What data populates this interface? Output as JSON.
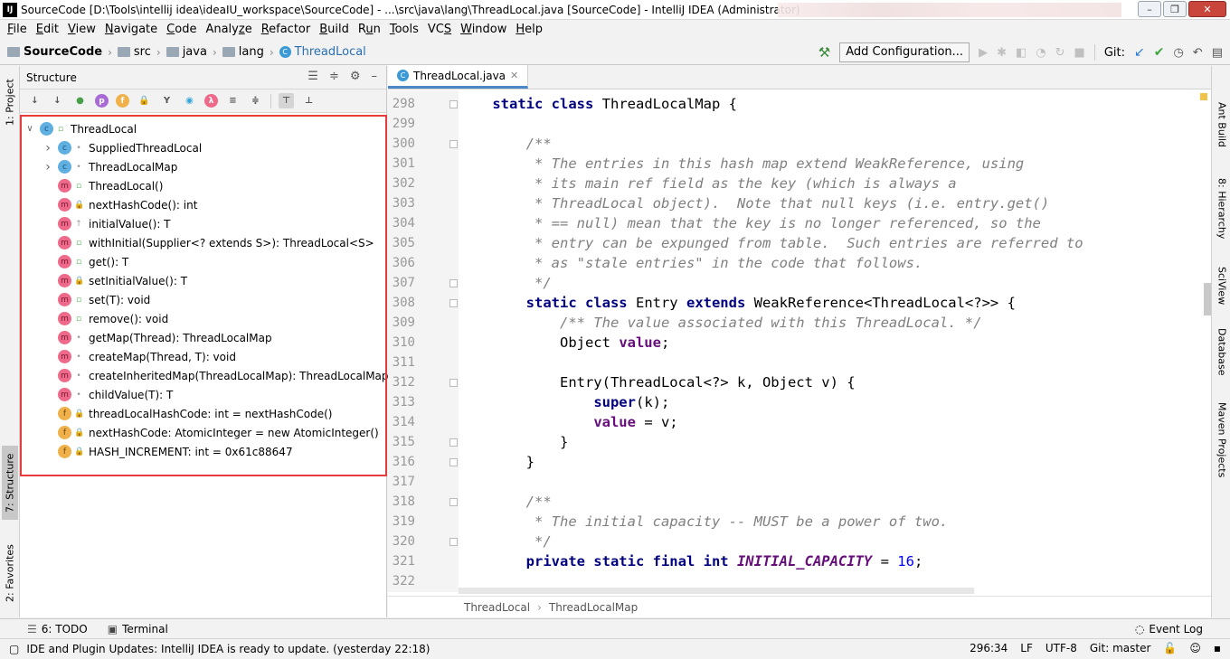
{
  "window": {
    "title": "SourceCode [D:\\Tools\\intellij idea\\ideaIU_workspace\\SourceCode] - ...\\src\\java\\lang\\ThreadLocal.java [SourceCode] - IntelliJ IDEA (Administrator)",
    "icon_text": "IJ"
  },
  "menu": [
    "File",
    "Edit",
    "View",
    "Navigate",
    "Code",
    "Analyze",
    "Refactor",
    "Build",
    "Run",
    "Tools",
    "VCS",
    "Window",
    "Help"
  ],
  "menu_mnemonics": [
    "F",
    "E",
    "V",
    "N",
    "C",
    "z",
    "R",
    "B",
    "u",
    "T",
    "S",
    "W",
    "H"
  ],
  "breadcrumbs": [
    {
      "label": "SourceCode",
      "icon": "folder-icon"
    },
    {
      "label": "src",
      "icon": "folder-icon"
    },
    {
      "label": "java",
      "icon": "folder-icon"
    },
    {
      "label": "lang",
      "icon": "folder-icon"
    },
    {
      "label": "ThreadLocal",
      "icon": "class-icon"
    }
  ],
  "toolbar": {
    "add_configuration": "Add Configuration...",
    "git_label": "Git:"
  },
  "left_tabs": [
    "1: Project",
    "7: Structure",
    "2: Favorites"
  ],
  "right_tabs": [
    "Ant Build",
    "8: Hierarchy",
    "SciView",
    "Database",
    "Maven Projects"
  ],
  "structure": {
    "title": "Structure",
    "toolbar_icons": [
      "sort-visibility-icon",
      "sort-alpha-icon",
      "show-inherited-icon",
      "show-properties-icon",
      "show-fields-icon",
      "show-non-public-icon",
      "show-lambdas-icon",
      "show-anonymous-icon",
      "lambda-icon",
      "expand-all-icon",
      "collapse-all-icon",
      "autoscroll-to-source-icon",
      "autoscroll-from-source-icon"
    ],
    "items": [
      {
        "label": "ThreadLocal",
        "kind": "c",
        "vis": "pub",
        "level": 0,
        "chevron": "down"
      },
      {
        "label": "SuppliedThreadLocal",
        "kind": "c",
        "vis": "pkg",
        "level": 1,
        "chevron": "right"
      },
      {
        "label": "ThreadLocalMap",
        "kind": "c",
        "vis": "pkg",
        "level": 1,
        "chevron": "right"
      },
      {
        "label": "ThreadLocal()",
        "kind": "m",
        "vis": "pub",
        "level": 1,
        "chevron": ""
      },
      {
        "label": "nextHashCode(): int",
        "kind": "m",
        "vis": "priv",
        "level": 1,
        "chevron": ""
      },
      {
        "label": "initialValue(): T",
        "kind": "m",
        "vis": "prot",
        "level": 1,
        "chevron": ""
      },
      {
        "label": "withInitial(Supplier<? extends S>): ThreadLocal<S>",
        "kind": "m",
        "vis": "pub",
        "level": 1,
        "chevron": ""
      },
      {
        "label": "get(): T",
        "kind": "m",
        "vis": "pub",
        "level": 1,
        "chevron": ""
      },
      {
        "label": "setInitialValue(): T",
        "kind": "m",
        "vis": "priv",
        "level": 1,
        "chevron": ""
      },
      {
        "label": "set(T): void",
        "kind": "m",
        "vis": "pub",
        "level": 1,
        "chevron": ""
      },
      {
        "label": "remove(): void",
        "kind": "m",
        "vis": "pub",
        "level": 1,
        "chevron": ""
      },
      {
        "label": "getMap(Thread): ThreadLocalMap",
        "kind": "m",
        "vis": "pkg",
        "level": 1,
        "chevron": ""
      },
      {
        "label": "createMap(Thread, T): void",
        "kind": "m",
        "vis": "pkg",
        "level": 1,
        "chevron": ""
      },
      {
        "label": "createInheritedMap(ThreadLocalMap): ThreadLocalMap",
        "kind": "m",
        "vis": "pkg",
        "level": 1,
        "chevron": ""
      },
      {
        "label": "childValue(T): T",
        "kind": "m",
        "vis": "pkg",
        "level": 1,
        "chevron": ""
      },
      {
        "label": "threadLocalHashCode: int = nextHashCode()",
        "kind": "f",
        "vis": "priv",
        "level": 1,
        "chevron": ""
      },
      {
        "label": "nextHashCode: AtomicInteger = new AtomicInteger()",
        "kind": "f",
        "vis": "priv",
        "level": 1,
        "chevron": ""
      },
      {
        "label": "HASH_INCREMENT: int = 0x61c88647",
        "kind": "f",
        "vis": "priv",
        "level": 1,
        "chevron": ""
      }
    ]
  },
  "editor": {
    "tab": "ThreadLocal.java",
    "breadcrumb": [
      "ThreadLocal",
      "ThreadLocalMap"
    ],
    "lines": [
      {
        "n": "298",
        "fold": true,
        "segs": [
          [
            "",
            "    "
          ],
          [
            "kw",
            "static class "
          ],
          [
            "pl",
            "ThreadLocalMap {"
          ]
        ]
      },
      {
        "n": "299",
        "fold": false,
        "segs": []
      },
      {
        "n": "300",
        "fold": true,
        "segs": [
          [
            "cm",
            "        /**"
          ]
        ]
      },
      {
        "n": "301",
        "fold": false,
        "segs": [
          [
            "cm",
            "         * The entries in this hash map extend WeakReference, using"
          ]
        ]
      },
      {
        "n": "302",
        "fold": false,
        "segs": [
          [
            "cm",
            "         * its main ref field as the key (which is always a"
          ]
        ]
      },
      {
        "n": "303",
        "fold": false,
        "segs": [
          [
            "cm",
            "         * ThreadLocal object).  Note that null keys (i.e. entry.get()"
          ]
        ]
      },
      {
        "n": "304",
        "fold": false,
        "segs": [
          [
            "cm",
            "         * == null) mean that the key is no longer referenced, so the"
          ]
        ]
      },
      {
        "n": "305",
        "fold": false,
        "segs": [
          [
            "cm",
            "         * entry can be expunged from table.  Such entries are referred to"
          ]
        ]
      },
      {
        "n": "306",
        "fold": false,
        "segs": [
          [
            "cm",
            "         * as \"stale entries\" in the code that follows."
          ]
        ]
      },
      {
        "n": "307",
        "fold": true,
        "segs": [
          [
            "cm",
            "         */"
          ]
        ]
      },
      {
        "n": "308",
        "fold": true,
        "segs": [
          [
            "",
            "        "
          ],
          [
            "kw",
            "static class "
          ],
          [
            "pl",
            "Entry "
          ],
          [
            "kw",
            "extends "
          ],
          [
            "pl",
            "WeakReference<ThreadLocal<?>> {"
          ]
        ]
      },
      {
        "n": "309",
        "fold": false,
        "segs": [
          [
            "",
            "            "
          ],
          [
            "cm",
            "/** The value associated with this ThreadLocal. */"
          ]
        ]
      },
      {
        "n": "310",
        "fold": false,
        "segs": [
          [
            "",
            "            "
          ],
          [
            "pl",
            "Object "
          ],
          [
            "fld",
            "value"
          ],
          [
            "pl",
            ";"
          ]
        ]
      },
      {
        "n": "311",
        "fold": false,
        "segs": []
      },
      {
        "n": "312",
        "fold": true,
        "segs": [
          [
            "",
            "            "
          ],
          [
            "pl",
            "Entry(ThreadLocal<?> k, Object v) {"
          ]
        ]
      },
      {
        "n": "313",
        "fold": false,
        "segs": [
          [
            "",
            "                "
          ],
          [
            "kw",
            "super"
          ],
          [
            "pl",
            "(k);"
          ]
        ]
      },
      {
        "n": "314",
        "fold": false,
        "segs": [
          [
            "",
            "                "
          ],
          [
            "fld",
            "value"
          ],
          [
            "pl",
            " = v;"
          ]
        ]
      },
      {
        "n": "315",
        "fold": true,
        "segs": [
          [
            "",
            "            "
          ],
          [
            "pl",
            "}"
          ]
        ]
      },
      {
        "n": "316",
        "fold": true,
        "segs": [
          [
            "",
            "        "
          ],
          [
            "pl",
            "}"
          ]
        ]
      },
      {
        "n": "317",
        "fold": false,
        "segs": []
      },
      {
        "n": "318",
        "fold": true,
        "segs": [
          [
            "cm",
            "        /**"
          ]
        ]
      },
      {
        "n": "319",
        "fold": false,
        "segs": [
          [
            "cm",
            "         * The initial capacity -- MUST be a power of two."
          ]
        ]
      },
      {
        "n": "320",
        "fold": true,
        "segs": [
          [
            "cm",
            "         */"
          ]
        ]
      },
      {
        "n": "321",
        "fold": false,
        "segs": [
          [
            "",
            "        "
          ],
          [
            "kw",
            "private static final int "
          ],
          [
            "cst",
            "INITIAL_CAPACITY"
          ],
          [
            "pl",
            " = "
          ],
          [
            "num",
            "16"
          ],
          [
            "pl",
            ";"
          ]
        ]
      },
      {
        "n": "322",
        "fold": false,
        "segs": []
      }
    ]
  },
  "bottom_tools": [
    {
      "label": "6: TODO",
      "icon": "todo-icon"
    },
    {
      "label": "Terminal",
      "icon": "terminal-icon"
    }
  ],
  "event_log": "Event Log",
  "status": {
    "message": "IDE and Plugin Updates: IntelliJ IDEA is ready to update. (yesterday 22:18)",
    "position": "296:34",
    "line_sep": "LF",
    "encoding": "UTF-8",
    "git": "Git: master"
  },
  "colors": {
    "highlight_border": "#e73c3c",
    "keyword": "#000080",
    "comment": "#808080",
    "field": "#660e7a",
    "number": "#0000ff"
  }
}
